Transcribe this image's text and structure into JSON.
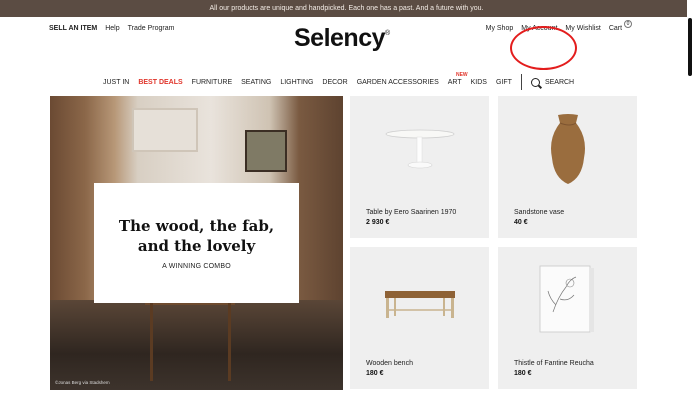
{
  "banner": {
    "text": "All our products are unique and handpicked. Each one has a past. And a future with you."
  },
  "header": {
    "left_links": [
      "SELL AN ITEM",
      "Help",
      "Trade Program"
    ],
    "logo": "Selency",
    "logo_mark": "®",
    "right_links": [
      "My Shop",
      "My Account",
      "My Wishlist",
      "Cart"
    ],
    "cart_count": "0"
  },
  "nav": {
    "items": [
      "JUST IN",
      "BEST DEALS",
      "FURNITURE",
      "SEATING",
      "LIGHTING",
      "DECOR",
      "GARDEN ACCESSORIES",
      "ART",
      "KIDS",
      "GIFT"
    ],
    "new_badge": "NEW",
    "search_label": "SEARCH"
  },
  "hero": {
    "title_line1": "The wood, the fab,",
    "title_line2": "and the lovely",
    "subtitle": "A WINNING COMBO",
    "credit": "©Jonas Berg via Stadshem"
  },
  "products": [
    {
      "title": "Table by Eero Saarinen 1970",
      "price": "2 930 €",
      "icon": "round-table-image"
    },
    {
      "title": "Sandstone vase",
      "price": "40 €",
      "icon": "vase-image"
    },
    {
      "title": "Wooden bench",
      "price": "180 €",
      "icon": "bench-image"
    },
    {
      "title": "Thistle of Fantine Reucha",
      "price": "180 €",
      "icon": "framed-drawing-image"
    }
  ],
  "colors": {
    "banner": "#5b4c43",
    "accent": "#e0352b",
    "annotation": "#e31d1d"
  }
}
